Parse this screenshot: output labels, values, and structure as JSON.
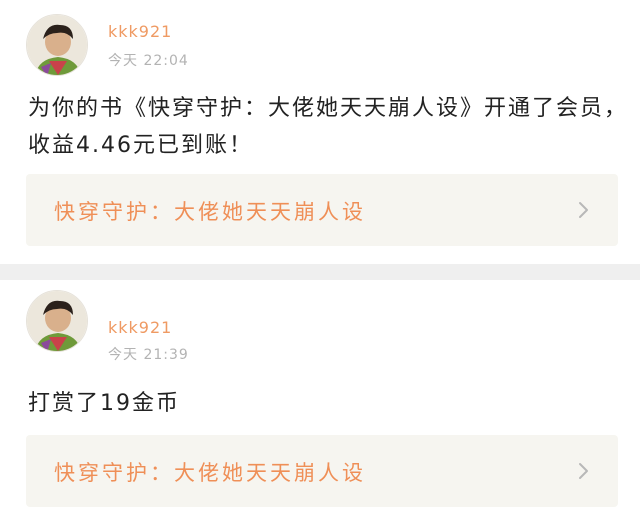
{
  "notifications": [
    {
      "username": "kkk921",
      "time": "今天 22:04",
      "message": "为你的书《快穿守护：大佬她天天崩人设》开通了会员，收益4.46元已到账！",
      "book_title": "快穿守护：大佬她天天崩人设",
      "chevron_icon": "chevron-right-icon"
    },
    {
      "username": "kkk921",
      "time": "今天 21:39",
      "message": "打赏了19金币",
      "book_title": "快穿守护：大佬她天天崩人设",
      "chevron_icon": "chevron-right-icon"
    }
  ],
  "colors": {
    "accent": "#ef8f57",
    "username": "#ef9a63",
    "timestamp": "#b3b3b3",
    "message_text": "#222222",
    "card_link_bg": "#f6f5f0",
    "divider": "#efefef"
  }
}
